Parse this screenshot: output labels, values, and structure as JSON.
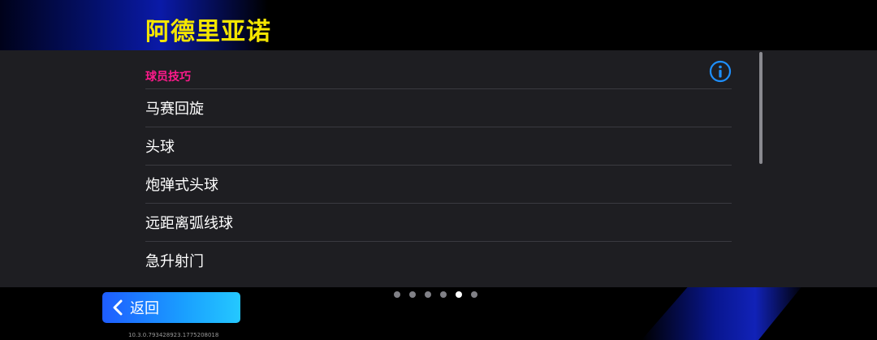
{
  "header": {
    "player_name": "阿德里亚诺"
  },
  "section": {
    "title": "球员技巧",
    "title_color": "#ff1a8c",
    "info_icon": "info-circle-icon"
  },
  "skills": [
    {
      "label": "马赛回旋"
    },
    {
      "label": "头球"
    },
    {
      "label": "炮弹式头球"
    },
    {
      "label": "远距离弧线球"
    },
    {
      "label": "急升射门"
    }
  ],
  "pagination": {
    "total": 6,
    "active_index": 4
  },
  "footer": {
    "back_label": "返回",
    "back_icon": "chevron-left-icon",
    "version": "10.3.0.793428923.1775208018"
  },
  "colors": {
    "name": "#f5e600",
    "accent_blue": "#1aa0ff",
    "panel": "#1e1e22"
  }
}
